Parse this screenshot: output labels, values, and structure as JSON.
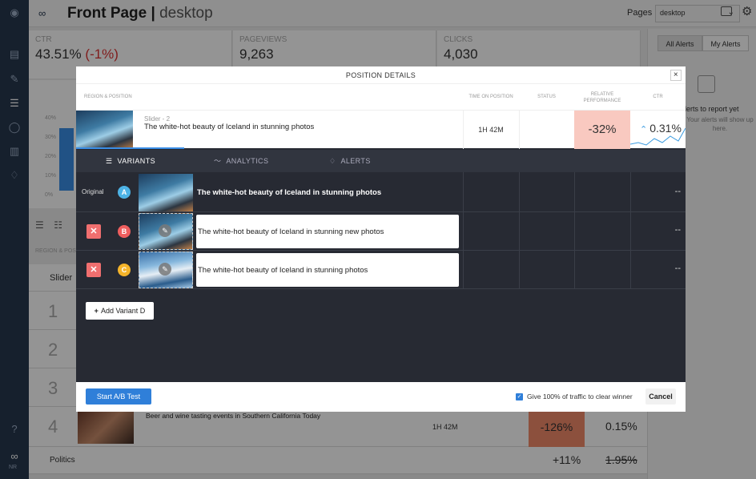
{
  "app": {
    "title": "Front Page",
    "subtitle": "desktop",
    "pages_label": "Pages",
    "pages_value": "desktop"
  },
  "metrics": [
    {
      "label": "CTR",
      "value": "43.51%",
      "delta": "(-1%)"
    },
    {
      "label": "PAGEVIEWS",
      "value": "9,263"
    },
    {
      "label": "CLICKS",
      "value": "4,030"
    }
  ],
  "right_panel": {
    "tab_all": "All Alerts",
    "tab_mine": "My Alerts",
    "empty_title": "Alerts to report yet",
    "empty_sub": "Your alerts will show up here."
  },
  "background": {
    "y_ticks": [
      "40%",
      "30%",
      "20%",
      "10%",
      "0%"
    ],
    "region_label": "REGION & POS",
    "slider_label": "Slider",
    "rows": [
      "1",
      "2",
      "3",
      "4"
    ],
    "row4_title": "Beer and wine tasting events in Southern California Today",
    "row4_time": "1H 42M",
    "row4_perf": "-126%",
    "row4_ctr": "0.15%",
    "politics_label": "Politics",
    "politics_perf": "+11%",
    "politics_ctr": "1.95%"
  },
  "modal": {
    "title": "POSITION DETAILS",
    "close": "×",
    "columns": {
      "region": "REGION & POSITION",
      "time": "TIME ON POSITION",
      "status": "STATUS",
      "perf": "RELATIVE PERFORMANCE",
      "ctr": "CTR"
    },
    "position": {
      "slot": "Slider - 2",
      "title": "The white-hot beauty of Iceland in stunning photos",
      "time": "1H 42M",
      "perf": "-32%",
      "ctr": "0.31%"
    },
    "tabs": [
      "VARIANTS",
      "ANALYTICS",
      "ALERTS"
    ],
    "variants": [
      {
        "label": "Original",
        "letter": "A",
        "title": "The white-hot beauty of Iceland in stunning photos",
        "value": "--",
        "color": "#4db3e6"
      },
      {
        "letter": "B",
        "title": "The white-hot beauty of Iceland in stunning new photos",
        "value": "--",
        "color": "#ef5e5e"
      },
      {
        "letter": "C",
        "title": "The white-hot beauty of Iceland in stunning photos",
        "value": "--",
        "color": "#f5b42a"
      }
    ],
    "add_variant": "Add Variant D",
    "start_button": "Start A/B Test",
    "traffic_label": "Give 100% of traffic to clear winner",
    "cancel": "Cancel"
  }
}
